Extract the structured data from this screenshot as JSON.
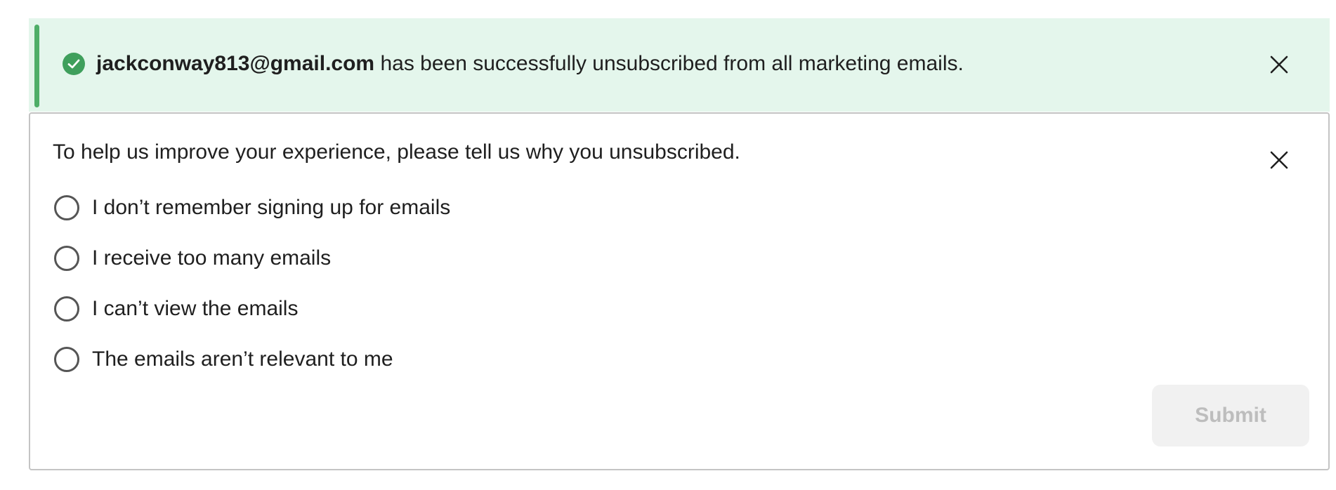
{
  "banner": {
    "email": "jackconway813@gmail.com",
    "message": " has been successfully unsubscribed from all marketing emails.",
    "status_icon": "check-circle-icon",
    "close_icon": "close-icon",
    "accent_color": "#4fae68",
    "background_color": "#e4f6ec"
  },
  "survey": {
    "prompt": "To help us improve your experience, please tell us why you unsubscribed.",
    "close_icon": "close-icon",
    "options": [
      {
        "label": "I don’t remember signing up for emails",
        "selected": false
      },
      {
        "label": "I receive too many emails",
        "selected": false
      },
      {
        "label": "I can’t view the emails",
        "selected": false
      },
      {
        "label": "The emails aren’t relevant to me",
        "selected": false
      }
    ],
    "submit_label": "Submit",
    "submit_disabled": true
  }
}
